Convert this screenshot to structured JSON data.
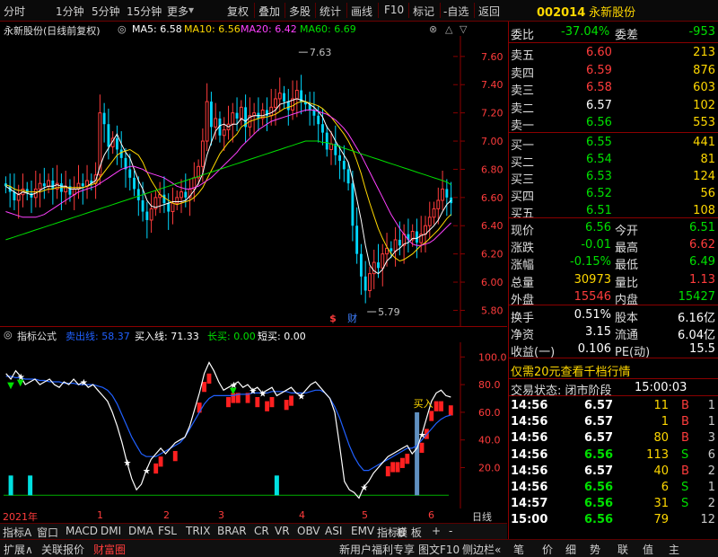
{
  "topbar": {
    "tabs": [
      "分时",
      "1分钟",
      "5分钟",
      "15分钟",
      "更多"
    ],
    "tools": [
      "复权",
      "叠加",
      "多股",
      "统计",
      "画线",
      "F10",
      "标记",
      "-自选",
      "返回"
    ],
    "stock_code": "002014",
    "stock_name": "永新股份"
  },
  "main_chart": {
    "name": "永新股份(日线前复权)",
    "ma_legend": [
      {
        "label": "MA5: 6.58",
        "color": "#ffffff"
      },
      {
        "label": "MA10: 6.56",
        "color": "#ffd800"
      },
      {
        "label": "MA20: 6.42",
        "color": "#ff40ff"
      },
      {
        "label": "MA60: 6.69",
        "color": "#00e000"
      }
    ],
    "high_label": "7.63",
    "low_label": "5.79",
    "markers": [
      "$",
      "财"
    ]
  },
  "indicator": {
    "name": "指标公式",
    "legend": [
      {
        "label": "卖出线: 58.37",
        "color": "#2060ff"
      },
      {
        "label": "买入线: 71.33",
        "color": "#ffffff"
      },
      {
        "label": "长买: 0.00",
        "color": "#00e000"
      },
      {
        "label": "短买: 0.00",
        "color": "#ffffff"
      }
    ],
    "buy_tag": "买入"
  },
  "chart_data": [
    {
      "type": "candlestick",
      "title": "永新股份(日线前复权)",
      "y_ticks": [
        5.8,
        6.0,
        6.2,
        6.4,
        6.6,
        6.8,
        7.0,
        7.2,
        7.4,
        7.6
      ],
      "ylim": [
        5.72,
        7.72
      ],
      "x_ticks": [
        "2021年",
        "1",
        "2",
        "3",
        "4",
        "5",
        "6"
      ],
      "close": [
        6.68,
        6.64,
        6.58,
        6.62,
        6.66,
        6.63,
        6.6,
        6.66,
        6.7,
        6.68,
        6.72,
        6.66,
        6.7,
        6.64,
        6.68,
        6.62,
        6.66,
        6.7,
        6.68,
        6.72,
        6.7,
        6.76,
        7.2,
        7.12,
        6.96,
        7.02,
        6.94,
        6.88,
        6.8,
        6.74,
        6.66,
        6.58,
        6.5,
        6.44,
        6.52,
        6.6,
        6.62,
        6.56,
        6.5,
        6.56,
        6.6,
        6.64,
        6.6,
        6.66,
        6.74,
        6.82,
        7.0,
        7.28,
        7.1,
        7.16,
        7.04,
        7.08,
        7.12,
        7.2,
        7.16,
        7.24,
        7.1,
        7.18,
        7.2,
        7.16,
        7.22,
        7.18,
        7.24,
        7.3,
        7.34,
        7.28,
        7.22,
        7.3,
        7.36,
        7.28,
        7.26,
        7.22,
        7.18,
        7.12,
        7.06,
        6.94,
        6.98,
        6.9,
        6.86,
        6.8,
        6.7,
        6.4,
        6.2,
        6.04,
        5.94,
        6.06,
        6.14,
        6.1,
        6.2,
        6.24,
        6.22,
        6.3,
        6.26,
        6.34,
        6.3,
        6.36,
        6.28,
        6.34,
        6.4,
        6.46,
        6.52,
        6.58,
        6.66,
        6.6,
        6.56
      ],
      "open": [
        6.7,
        6.68,
        6.64,
        6.58,
        6.62,
        6.66,
        6.63,
        6.6,
        6.66,
        6.7,
        6.68,
        6.72,
        6.66,
        6.7,
        6.64,
        6.68,
        6.62,
        6.66,
        6.7,
        6.68,
        6.72,
        6.7,
        6.76,
        7.2,
        7.12,
        6.96,
        7.02,
        6.94,
        6.88,
        6.8,
        6.74,
        6.66,
        6.58,
        6.5,
        6.44,
        6.52,
        6.6,
        6.62,
        6.56,
        6.5,
        6.56,
        6.6,
        6.64,
        6.6,
        6.66,
        6.74,
        6.82,
        7.0,
        7.28,
        7.1,
        7.16,
        7.04,
        7.08,
        7.12,
        7.2,
        7.16,
        7.24,
        7.1,
        7.18,
        7.2,
        7.16,
        7.22,
        7.18,
        7.24,
        7.3,
        7.34,
        7.28,
        7.22,
        7.3,
        7.36,
        7.28,
        7.26,
        7.22,
        7.18,
        7.12,
        7.06,
        6.94,
        6.98,
        6.9,
        6.86,
        6.8,
        6.7,
        6.4,
        6.2,
        6.04,
        5.94,
        6.06,
        6.14,
        6.1,
        6.2,
        6.24,
        6.22,
        6.3,
        6.26,
        6.34,
        6.3,
        6.36,
        6.28,
        6.34,
        6.4,
        6.46,
        6.52,
        6.58,
        6.66,
        6.6
      ],
      "ma_series": [
        {
          "name": "MA5",
          "color": "#ffffff",
          "values": [
            6.68,
            6.66,
            6.64,
            6.62,
            6.64,
            6.63,
            6.62,
            6.63,
            6.65,
            6.67,
            6.68,
            6.68,
            6.69,
            6.68,
            6.68,
            6.66,
            6.66,
            6.66,
            6.67,
            6.68,
            6.7,
            6.72,
            6.82,
            6.9,
            6.95,
            7.0,
            7.05,
            6.98,
            6.92,
            6.88,
            6.8,
            6.72,
            6.66,
            6.58,
            6.54,
            6.53,
            6.54,
            6.55,
            6.56,
            6.57,
            6.57,
            6.57,
            6.58,
            6.61,
            6.65,
            6.7,
            6.77,
            6.9,
            6.99,
            7.07,
            7.11,
            7.12,
            7.1,
            7.12,
            7.12,
            7.16,
            7.14,
            7.17,
            7.18,
            7.18,
            7.18,
            7.19,
            7.2,
            7.22,
            7.26,
            7.27,
            7.28,
            7.29,
            7.3,
            7.29,
            7.28,
            7.26,
            7.24,
            7.21,
            7.17,
            7.1,
            7.06,
            7.0,
            6.95,
            6.9,
            6.85,
            6.73,
            6.59,
            6.44,
            6.26,
            6.12,
            6.08,
            6.06,
            6.09,
            6.15,
            6.18,
            6.22,
            6.24,
            6.27,
            6.28,
            6.31,
            6.31,
            6.33,
            6.34,
            6.37,
            6.4,
            6.44,
            6.5,
            6.55,
            6.58
          ]
        },
        {
          "name": "MA10",
          "color": "#ffd800",
          "values": [
            6.69,
            6.68,
            6.66,
            6.65,
            6.65,
            6.64,
            6.64,
            6.64,
            6.64,
            6.65,
            6.66,
            6.66,
            6.67,
            6.67,
            6.67,
            6.67,
            6.67,
            6.67,
            6.67,
            6.68,
            6.69,
            6.7,
            6.74,
            6.78,
            6.82,
            6.86,
            6.9,
            6.92,
            6.93,
            6.94,
            6.92,
            6.9,
            6.85,
            6.78,
            6.72,
            6.67,
            6.62,
            6.6,
            6.58,
            6.56,
            6.55,
            6.56,
            6.57,
            6.58,
            6.6,
            6.63,
            6.67,
            6.73,
            6.79,
            6.85,
            6.91,
            6.95,
            6.99,
            7.02,
            7.05,
            7.1,
            7.12,
            7.14,
            7.15,
            7.16,
            7.17,
            7.17,
            7.18,
            7.19,
            7.21,
            7.23,
            7.24,
            7.25,
            7.27,
            7.28,
            7.28,
            7.27,
            7.26,
            7.25,
            7.23,
            7.2,
            7.17,
            7.13,
            7.09,
            7.05,
            7.0,
            6.94,
            6.86,
            6.77,
            6.66,
            6.56,
            6.47,
            6.38,
            6.31,
            6.25,
            6.2,
            6.17,
            6.15,
            6.16,
            6.18,
            6.2,
            6.23,
            6.26,
            6.28,
            6.31,
            6.34,
            6.37,
            6.41,
            6.45,
            6.48
          ]
        },
        {
          "name": "MA20",
          "color": "#ff40ff",
          "values": [
            6.5,
            6.49,
            6.48,
            6.47,
            6.46,
            6.46,
            6.46,
            6.46,
            6.47,
            6.48,
            6.5,
            6.52,
            6.54,
            6.56,
            6.58,
            6.6,
            6.62,
            6.64,
            6.65,
            6.66,
            6.67,
            6.68,
            6.7,
            6.72,
            6.74,
            6.76,
            6.78,
            6.8,
            6.81,
            6.82,
            6.82,
            6.81,
            6.8,
            6.78,
            6.77,
            6.76,
            6.75,
            6.74,
            6.72,
            6.7,
            6.68,
            6.67,
            6.66,
            6.66,
            6.67,
            6.68,
            6.7,
            6.72,
            6.74,
            6.77,
            6.8,
            6.83,
            6.86,
            6.89,
            6.92,
            6.96,
            6.99,
            7.02,
            7.05,
            7.08,
            7.1,
            7.12,
            7.14,
            7.15,
            7.16,
            7.17,
            7.18,
            7.19,
            7.2,
            7.21,
            7.22,
            7.22,
            7.22,
            7.21,
            7.2,
            7.19,
            7.17,
            7.15,
            7.12,
            7.09,
            7.05,
            7.0,
            6.95,
            6.9,
            6.84,
            6.78,
            6.72,
            6.66,
            6.6,
            6.54,
            6.48,
            6.43,
            6.38,
            6.34,
            6.3,
            6.27,
            6.26,
            6.26,
            6.27,
            6.28,
            6.3,
            6.33,
            6.36,
            6.39,
            6.42
          ]
        },
        {
          "name": "MA60",
          "color": "#00e000",
          "values": [
            6.3,
            6.31,
            6.32,
            6.33,
            6.34,
            6.35,
            6.36,
            6.37,
            6.38,
            6.39,
            6.4,
            6.41,
            6.42,
            6.43,
            6.44,
            6.45,
            6.46,
            6.47,
            6.48,
            6.49,
            6.5,
            6.51,
            6.52,
            6.53,
            6.54,
            6.55,
            6.56,
            6.57,
            6.58,
            6.59,
            6.6,
            6.61,
            6.62,
            6.63,
            6.64,
            6.65,
            6.66,
            6.67,
            6.68,
            6.69,
            6.7,
            6.71,
            6.72,
            6.73,
            6.74,
            6.75,
            6.76,
            6.77,
            6.78,
            6.79,
            6.8,
            6.81,
            6.82,
            6.83,
            6.84,
            6.85,
            6.86,
            6.87,
            6.88,
            6.89,
            6.9,
            6.91,
            6.92,
            6.93,
            6.94,
            6.95,
            6.96,
            6.97,
            6.98,
            6.99,
            7.0,
            7.0,
            7.0,
            7.0,
            6.99,
            6.99,
            6.98,
            6.97,
            6.96,
            6.95,
            6.94,
            6.93,
            6.92,
            6.91,
            6.9,
            6.89,
            6.88,
            6.87,
            6.86,
            6.85,
            6.84,
            6.83,
            6.82,
            6.81,
            6.8,
            6.79,
            6.78,
            6.77,
            6.76,
            6.75,
            6.74,
            6.73,
            6.72,
            6.71,
            6.69
          ]
        }
      ]
    },
    {
      "type": "line",
      "title": "指标公式",
      "y_ticks": [
        20.0,
        40.0,
        60.0,
        80.0,
        100.0
      ],
      "ylim": [
        -5,
        108
      ],
      "series": [
        {
          "name": "买入线",
          "color": "#ffffff",
          "values": [
            88,
            84,
            90,
            86,
            80,
            82,
            84,
            80,
            82,
            84,
            80,
            78,
            82,
            80,
            84,
            80,
            82,
            78,
            80,
            76,
            72,
            68,
            60,
            50,
            38,
            24,
            12,
            4,
            8,
            18,
            26,
            30,
            34,
            30,
            34,
            38,
            40,
            42,
            50,
            62,
            74,
            88,
            96,
            90,
            82,
            76,
            78,
            80,
            82,
            78,
            80,
            76,
            78,
            74,
            76,
            78,
            72,
            74,
            76,
            78,
            74,
            72,
            76,
            80,
            82,
            78,
            74,
            70,
            60,
            36,
            10,
            4,
            2,
            -2,
            6,
            10,
            16,
            20,
            24,
            28,
            30,
            32,
            34,
            36,
            30,
            34,
            44,
            56,
            68,
            74,
            76,
            72,
            71
          ]
        },
        {
          "name": "卖出线",
          "color": "#2060ff",
          "values": [
            86,
            86,
            85,
            85,
            84,
            84,
            84,
            83,
            83,
            82,
            82,
            82,
            81,
            81,
            81,
            80,
            80,
            80,
            80,
            79,
            78,
            76,
            72,
            66,
            58,
            50,
            42,
            36,
            30,
            28,
            28,
            28,
            30,
            32,
            34,
            36,
            38,
            42,
            48,
            54,
            60,
            66,
            70,
            72,
            72,
            72,
            72,
            72,
            73,
            73,
            73,
            74,
            74,
            74,
            74,
            75,
            75,
            75,
            75,
            74,
            74,
            74,
            74,
            75,
            76,
            76,
            74,
            70,
            64,
            56,
            46,
            36,
            28,
            22,
            18,
            18,
            20,
            22,
            24,
            26,
            28,
            30,
            32,
            34,
            34,
            36,
            40,
            44,
            48,
            52,
            55,
            57,
            58
          ]
        }
      ]
    }
  ],
  "quote": {
    "weibi": {
      "label": "委比",
      "value": "-37.04%",
      "label2": "委差",
      "value2": "-953"
    },
    "asks": [
      {
        "label": "卖五",
        "price": "6.60",
        "vol": "213"
      },
      {
        "label": "卖四",
        "price": "6.59",
        "vol": "876"
      },
      {
        "label": "卖三",
        "price": "6.58",
        "vol": "603"
      },
      {
        "label": "卖二",
        "price": "6.57",
        "vol": "102"
      },
      {
        "label": "卖一",
        "price": "6.56",
        "vol": "553"
      }
    ],
    "bids": [
      {
        "label": "买一",
        "price": "6.55",
        "vol": "441"
      },
      {
        "label": "买二",
        "price": "6.54",
        "vol": "81"
      },
      {
        "label": "买三",
        "price": "6.53",
        "vol": "124"
      },
      {
        "label": "买四",
        "price": "6.52",
        "vol": "56"
      },
      {
        "label": "买五",
        "price": "6.51",
        "vol": "108"
      }
    ],
    "stats": [
      {
        "l1": "现价",
        "v1": "6.56",
        "c1": "grn",
        "l2": "今开",
        "v2": "6.51",
        "c2": "grn"
      },
      {
        "l1": "涨跌",
        "v1": "-0.01",
        "c1": "grn",
        "l2": "最高",
        "v2": "6.62",
        "c2": "red"
      },
      {
        "l1": "涨幅",
        "v1": "-0.15%",
        "c1": "grn",
        "l2": "最低",
        "v2": "6.49",
        "c2": "grn"
      },
      {
        "l1": "总量",
        "v1": "30973",
        "c1": "yel",
        "l2": "量比",
        "v2": "1.13",
        "c2": "red"
      },
      {
        "l1": "外盘",
        "v1": "15546",
        "c1": "red",
        "l2": "内盘",
        "v2": "15427",
        "c2": "grn"
      }
    ],
    "stats2": [
      {
        "l1": "换手",
        "v1": "0.51%",
        "l2": "股本",
        "v2": "6.16亿"
      },
      {
        "l1": "净资",
        "v1": "3.15",
        "l2": "流通",
        "v2": "6.04亿"
      },
      {
        "l1": "收益(一)",
        "v1": "0.106",
        "l2": "PE(动)",
        "v2": "15.5"
      }
    ],
    "promo": "仅需20元查看千档行情",
    "trade_state": "交易状态: 闭市阶段",
    "trade_time": "15:00:03",
    "ticks": [
      {
        "t": "14:56",
        "p": "6.57",
        "pc": "wht",
        "v": "11",
        "bs": "B",
        "n": "1"
      },
      {
        "t": "14:56",
        "p": "6.57",
        "pc": "wht",
        "v": "1",
        "bs": "B",
        "n": "1"
      },
      {
        "t": "14:56",
        "p": "6.57",
        "pc": "wht",
        "v": "80",
        "bs": "B",
        "n": "3"
      },
      {
        "t": "14:56",
        "p": "6.56",
        "pc": "grn",
        "v": "113",
        "bs": "S",
        "n": "6"
      },
      {
        "t": "14:56",
        "p": "6.57",
        "pc": "wht",
        "v": "40",
        "bs": "B",
        "n": "2"
      },
      {
        "t": "14:56",
        "p": "6.56",
        "pc": "grn",
        "v": "6",
        "bs": "S",
        "n": "1"
      },
      {
        "t": "14:57",
        "p": "6.56",
        "pc": "grn",
        "v": "31",
        "bs": "S",
        "n": "2"
      },
      {
        "t": "15:00",
        "p": "6.56",
        "pc": "grn",
        "v": "79",
        "bs": "",
        "n": "12"
      }
    ]
  },
  "year_bar": {
    "year": "2021年",
    "period": "日线"
  },
  "indicator_tabs": [
    "指标A",
    "窗口",
    "MACD",
    "DMI",
    "DMA",
    "FSL",
    "TRIX",
    "BRAR",
    "CR",
    "VR",
    "OBV",
    "ASI",
    "EMV",
    "指标B",
    "模 板",
    "+",
    "-"
  ],
  "bottom_bar": {
    "left": [
      "扩展∧",
      "关联报价",
      "财富圈"
    ],
    "right": [
      "新用户福利专享",
      "图文F10",
      "侧边栏«"
    ],
    "side_tabs": [
      "笔",
      "价",
      "细",
      "势",
      "联",
      "值",
      "主"
    ]
  }
}
